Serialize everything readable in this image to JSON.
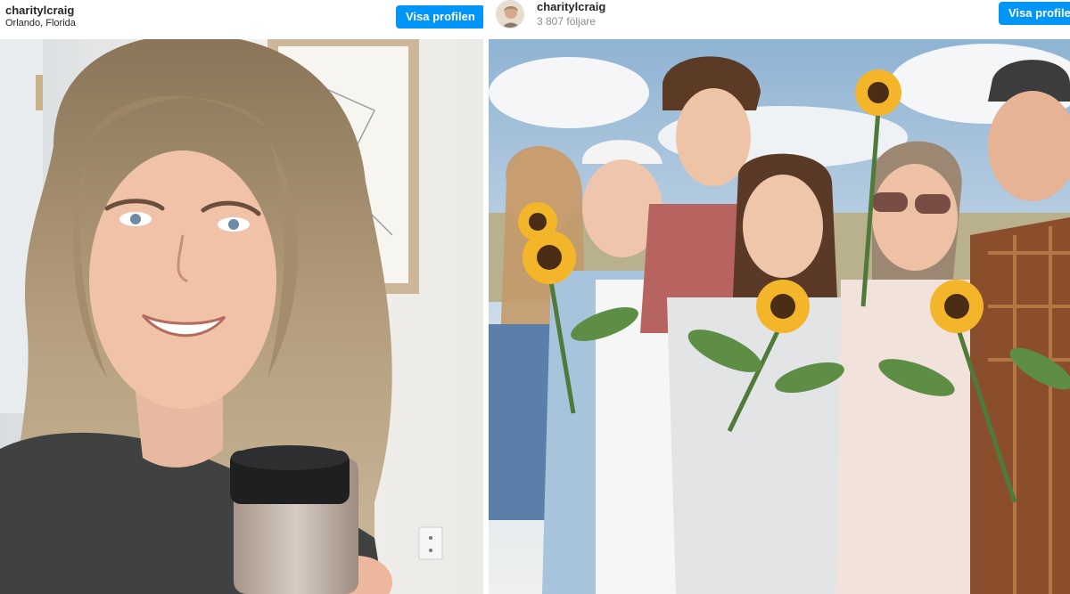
{
  "left_post": {
    "username": "charitylcraig",
    "location": "Orlando, Florida",
    "button_label": "Visa profilen"
  },
  "right_post": {
    "username": "charitylcraig",
    "followers": "3 807 följare",
    "button_label": "Visa profilen"
  },
  "colors": {
    "button_blue": "#0095f6",
    "text_dark": "#262626",
    "text_grey": "#8e8e8e"
  },
  "icons": [
    "profile-avatar"
  ]
}
